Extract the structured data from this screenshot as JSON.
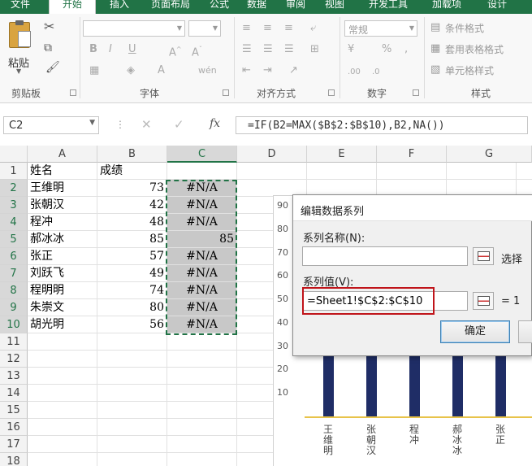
{
  "ribbon": {
    "tabs": [
      "文件",
      "开始",
      "插入",
      "页面布局",
      "公式",
      "数据",
      "审阅",
      "视图",
      "开发工具",
      "加载项",
      "设计"
    ],
    "active_tab_index": 1,
    "groups": {
      "clipboard": {
        "label": "剪贴板",
        "paste_label": "粘贴"
      },
      "font": {
        "label": "字体"
      },
      "alignment": {
        "label": "对齐方式"
      },
      "number": {
        "label": "数字",
        "format_value": "常规",
        "percent": "%"
      },
      "styles": {
        "label": "样式",
        "conditional_format": "条件格式",
        "table_format": "套用表格格式",
        "cell_styles": "单元格样式"
      }
    }
  },
  "formula_bar": {
    "name_box": "C2",
    "formula": "=IF(B2=MAX($B$2:$B$10),B2,NA())",
    "fx": "fx"
  },
  "sheet": {
    "columns": [
      "A",
      "B",
      "C",
      "D",
      "E",
      "F",
      "G"
    ],
    "selected_column": "C",
    "row_numbers": [
      "1",
      "2",
      "3",
      "4",
      "5",
      "6",
      "7",
      "8",
      "9",
      "10",
      "11",
      "12",
      "13",
      "14",
      "15",
      "16",
      "17",
      "18"
    ],
    "header_row": {
      "a": "姓名",
      "b": "成绩"
    },
    "rows": [
      {
        "name": "王维明",
        "score": "73",
        "c": "#N/A"
      },
      {
        "name": "张朝汉",
        "score": "42",
        "c": "#N/A"
      },
      {
        "name": "程冲",
        "score": "48",
        "c": "#N/A"
      },
      {
        "name": "郝冰冰",
        "score": "85",
        "c": "85"
      },
      {
        "name": "张正",
        "score": "57",
        "c": "#N/A"
      },
      {
        "name": "刘跃飞",
        "score": "49",
        "c": "#N/A"
      },
      {
        "name": "程明明",
        "score": "74",
        "c": "#N/A"
      },
      {
        "name": "朱崇文",
        "score": "80",
        "c": "#N/A"
      },
      {
        "name": "胡光明",
        "score": "56",
        "c": "#N/A"
      }
    ]
  },
  "chart_data": {
    "type": "bar",
    "y_ticks": [
      "90",
      "80",
      "70",
      "60",
      "50",
      "40",
      "30",
      "20",
      "10"
    ],
    "ylim": [
      0,
      90
    ],
    "categories": [
      "王维明",
      "张朝汉",
      "程冲",
      "郝冰冰",
      "张正"
    ],
    "series": [
      {
        "values": [
          73,
          42,
          48,
          85,
          57
        ]
      }
    ],
    "colors": {
      "bar": "#1f2d66",
      "baseline": "#e8c34a"
    }
  },
  "dialog": {
    "title": "编辑数据系列",
    "series_name_label": "系列名称(N):",
    "series_name_value": "",
    "select_label": "选择",
    "series_values_label": "系列值(V):",
    "series_values_value": "=Sheet1!$C$2:$C$10",
    "preview": "= 1",
    "ok_label": "确定"
  },
  "colors": {
    "excel_green": "#217346",
    "highlight_red": "#c0141a"
  }
}
